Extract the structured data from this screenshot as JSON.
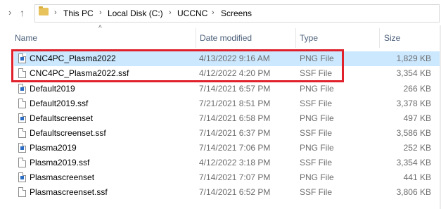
{
  "address_bar": {
    "breadcrumbs": [
      "This PC",
      "Local Disk (C:)",
      "UCCNC",
      "Screens"
    ],
    "icons": {
      "back": "chevron-right-icon",
      "up": "arrow-up-icon",
      "folder": "folder-icon"
    }
  },
  "columns": {
    "name": "Name",
    "date": "Date modified",
    "type": "Type",
    "size": "Size"
  },
  "files": [
    {
      "name": "CNC4PC_Plasma2022",
      "date": "4/13/2022 9:16 AM",
      "type": "PNG File",
      "size": "1,829 KB",
      "icon": "png-file-icon",
      "selected": true
    },
    {
      "name": "CNC4PC_Plasma2022.ssf",
      "date": "4/12/2022 4:20 PM",
      "type": "SSF File",
      "size": "3,354 KB",
      "icon": "file-icon",
      "selected": false
    },
    {
      "name": "Default2019",
      "date": "7/14/2021 6:57 PM",
      "type": "PNG File",
      "size": "266 KB",
      "icon": "png-file-icon",
      "selected": false
    },
    {
      "name": "Default2019.ssf",
      "date": "7/21/2021 8:51 PM",
      "type": "SSF File",
      "size": "3,378 KB",
      "icon": "file-icon",
      "selected": false
    },
    {
      "name": "Defaultscreenset",
      "date": "7/14/2021 6:58 PM",
      "type": "PNG File",
      "size": "497 KB",
      "icon": "png-file-icon",
      "selected": false
    },
    {
      "name": "Defaultscreenset.ssf",
      "date": "7/14/2021 6:37 PM",
      "type": "SSF File",
      "size": "3,586 KB",
      "icon": "file-icon",
      "selected": false
    },
    {
      "name": "Plasma2019",
      "date": "7/14/2021 7:06 PM",
      "type": "PNG File",
      "size": "252 KB",
      "icon": "png-file-icon",
      "selected": false
    },
    {
      "name": "Plasma2019.ssf",
      "date": "4/12/2022 3:18 PM",
      "type": "SSF File",
      "size": "3,354 KB",
      "icon": "file-icon",
      "selected": false
    },
    {
      "name": "Plasmascreenset",
      "date": "7/14/2021 7:07 PM",
      "type": "PNG File",
      "size": "441 KB",
      "icon": "png-file-icon",
      "selected": false
    },
    {
      "name": "Plasmascreenset.ssf",
      "date": "7/14/2021 6:52 PM",
      "type": "SSF File",
      "size": "3,806 KB",
      "icon": "file-icon",
      "selected": false
    }
  ],
  "colors": {
    "selection": "#cce8ff",
    "highlight_box": "#e0202a",
    "header_text": "#4c607a",
    "meta_text": "#6d6d6d"
  }
}
